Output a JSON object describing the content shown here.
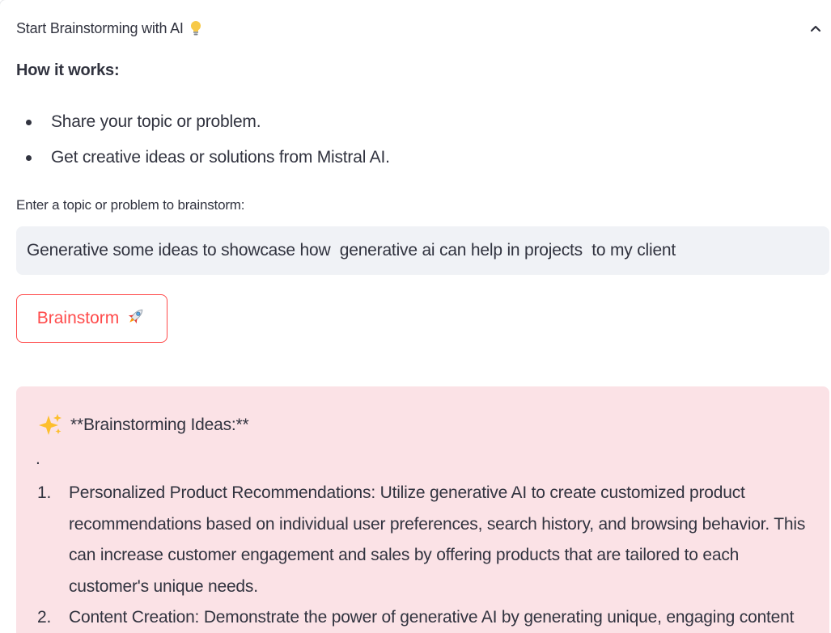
{
  "expander": {
    "title": "Start Brainstorming with AI",
    "title_icon": "lightbulb-icon",
    "toggle_icon": "chevron-up-icon"
  },
  "how_it_works": {
    "heading": "How it works:",
    "steps": [
      "Share your topic or problem.",
      "Get creative ideas or solutions from Mistral AI."
    ]
  },
  "input": {
    "label": "Enter a topic or problem to brainstorm:",
    "value": "Generative some ideas to showcase how  generative ai can help in projects  to my client"
  },
  "button": {
    "label": "Brainstorm",
    "icon": "rocket-icon"
  },
  "result": {
    "icon": "sparkles-icon",
    "heading": "**Brainstorming Ideas:**",
    "separator": ".",
    "ideas": [
      {
        "number": "1.",
        "text": "Personalized Product Recommendations: Utilize generative AI to create customized product recommendations based on individual user preferences, search history, and browsing behavior. This can increase customer engagement and sales by offering products that are tailored to each customer's unique needs."
      },
      {
        "number": "2.",
        "text": "Content Creation: Demonstrate the power of generative AI by generating unique, engaging content for your client's website, blog, or social media channels."
      }
    ]
  },
  "colors": {
    "accent": "#ff4b4b",
    "text": "#31333f",
    "input_bg": "#f0f2f6",
    "result_bg": "#fbe2e6"
  }
}
